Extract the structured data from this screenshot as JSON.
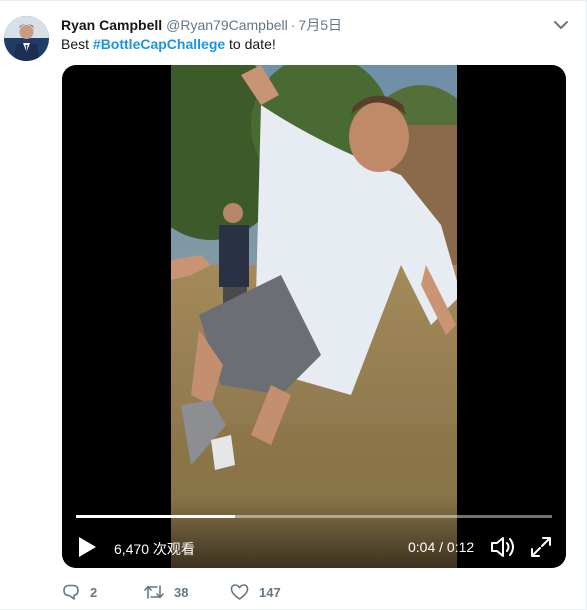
{
  "tweet": {
    "name": "Ryan Campbell",
    "handle": "@Ryan79Campbell",
    "separator": "·",
    "time": "7月5日",
    "text_before": "Best ",
    "hashtag": "#BottleCapChallege",
    "text_after": " to date!"
  },
  "video": {
    "progress": 0.333,
    "views": "6,470 次观看",
    "time": "0:04 / 0:12"
  },
  "actions": {
    "replies": "2",
    "retweets": "38",
    "likes": "147"
  },
  "colors": {
    "accent": "#1b95e0",
    "muted": "#657786",
    "text": "#14171a"
  },
  "icons": {
    "caret": "chevron-down-icon",
    "play": "play-icon",
    "volume": "volume-icon",
    "fullscreen": "fullscreen-icon",
    "reply": "reply-icon",
    "retweet": "retweet-icon",
    "like": "heart-icon"
  }
}
